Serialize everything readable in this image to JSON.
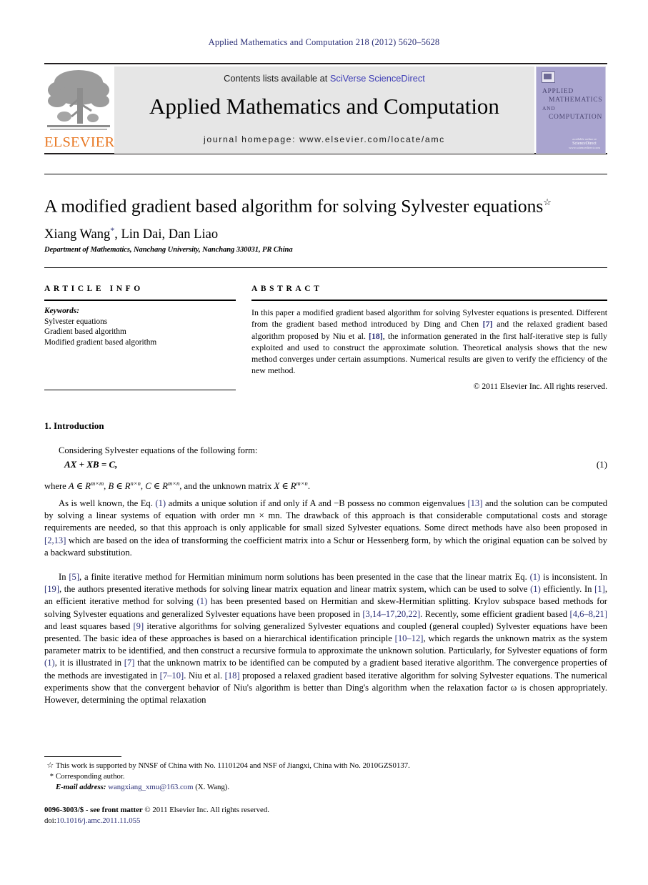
{
  "running_head": "Applied Mathematics and Computation 218 (2012) 5620–5628",
  "masthead": {
    "publisher": "ELSEVIER",
    "contents_prefix": "Contents lists available at ",
    "contents_link": "SciVerse ScienceDirect",
    "journal_title": "Applied Mathematics and Computation",
    "homepage": "journal homepage: www.elsevier.com/locate/amc",
    "cover": {
      "line1": "APPLIED",
      "line2": "MATHEMATICS",
      "line3": "AND",
      "line4": "COMPUTATION",
      "foot_small": "available online at",
      "foot_brand": "ScienceDirect",
      "foot_url": "www.sciencedirect.com"
    }
  },
  "article": {
    "title": "A modified gradient based algorithm for solving Sylvester equations",
    "title_footnote_mark": "☆",
    "authors": "Xiang Wang",
    "corresponding_mark": "*",
    "authors_rest": ", Lin Dai, Dan Liao",
    "affiliation": "Department of Mathematics, Nanchang University, Nanchang 330031, PR China"
  },
  "info": {
    "heading": "ARTICLE INFO",
    "keywords_label": "Keywords:",
    "keywords": [
      "Sylvester equations",
      "Gradient based algorithm",
      "Modified gradient based algorithm"
    ]
  },
  "abstract": {
    "heading": "ABSTRACT",
    "text_1": "In this paper a modified gradient based algorithm for solving Sylvester equations is presented. Different from the gradient based method introduced by Ding and Chen ",
    "ref_7": "[7]",
    "text_2": " and the relaxed gradient based algorithm proposed by Niu et al. ",
    "ref_18": "[18]",
    "text_3": ", the information generated in the first half-iterative step is fully exploited and used to construct the approximate solution. Theoretical analysis shows that the new method converges under certain assumptions. Numerical results are given to verify the efficiency of the new method.",
    "copyright": "© 2011 Elsevier Inc. All rights reserved."
  },
  "body": {
    "section_title": "1. Introduction",
    "p_considering": "Considering Sylvester equations of the following form:",
    "equation": "AX + XB = C,",
    "equation_number": "(1)",
    "p_where_pre": "where ",
    "p_where_post": ", and the unknown matrix ",
    "dims": {
      "A": "m×m",
      "B": "n×n",
      "C": "m×n",
      "X": "m×n"
    },
    "p_wellknown": {
      "s1": "As is well known, the Eq. ",
      "r1": "(1)",
      "s2": " admits a unique solution if and only if A and −B possess no common eigenvalues ",
      "r2": "[13]",
      "s3": " and the solution can be computed by solving a linear systems of equation with order mn × mn. The drawback of this approach is that considerable computational costs and storage requirements are needed, so that this approach is only applicable for small sized Sylvester equations. Some direct methods have also been proposed in ",
      "r3": "[2,13]",
      "s4": " which are based on the idea of transforming the coefficient matrix into a Schur or Hessenberg form, by which the original equation can be solved by a backward substitution."
    },
    "p_in5": {
      "s1": "In ",
      "r1": "[5]",
      "s2": ", a finite iterative method for Hermitian minimum norm solutions has been presented in the case that the linear matrix Eq. ",
      "r2": "(1)",
      "s3": " is inconsistent. In ",
      "r3": "[19]",
      "s4": ", the authors presented iterative methods for solving linear matrix equation and linear matrix system, which can be used to solve ",
      "r4": "(1)",
      "s5": " efficiently. In ",
      "r5": "[1]",
      "s6": ", an efficient iterative method for solving ",
      "r6": "(1)",
      "s7": " has been presented based on Hermitian and skew-Hermitian splitting. Krylov subspace based methods for solving Sylvester equations and generalized Sylvester equations have been proposed in ",
      "r7": "[3,14–17,20,22]",
      "s8": ". Recently, some efficient gradient based ",
      "r8": "[4,6–8,21]",
      "s9": " and least squares based ",
      "r9": "[9]",
      "s10": " iterative algorithms for solving generalized Sylvester equations and coupled (general coupled) Sylvester equations have been presented. The basic idea of these approaches is based on a hierarchical identification principle ",
      "r10": "[10–12]",
      "s11": ", which regards the unknown matrix as the system parameter matrix to be identified, and then construct a recursive formula to approximate the unknown solution. Particularly, for Sylvester equations of form ",
      "r11": "(1)",
      "s12": ", it is illustrated in ",
      "r12": "[7]",
      "s13": " that the unknown matrix to be identified can be computed by a gradient based iterative algorithm. The convergence properties of the methods are investigated in ",
      "r13": "[7–10]",
      "s14": ". Niu et al. ",
      "r14": "[18]",
      "s15": " proposed a relaxed gradient based iterative algorithm for solving Sylvester equations. The numerical experiments show that the convergent behavior of Niu's algorithm is better than Ding's algorithm when the relaxation factor ω is chosen appropriately. However, determining the optimal relaxation"
    }
  },
  "footnotes": {
    "funding_mark": "☆",
    "funding_text": "This work is supported by NNSF of China with No. 11101204 and NSF of Jiangxi, China with No. 2010GZS0137.",
    "corresponding_mark": "*",
    "corresponding_text": "Corresponding author.",
    "email_label": "E-mail address:",
    "email_address": "wangxiang_xmu@163.com",
    "email_attrib": "(X. Wang)."
  },
  "imprint": {
    "issn": "0096-3003/$ - see front matter",
    "copyright": "© 2011 Elsevier Inc. All rights reserved.",
    "doi_label": "doi:",
    "doi_value": "10.1016/j.amc.2011.11.055"
  }
}
